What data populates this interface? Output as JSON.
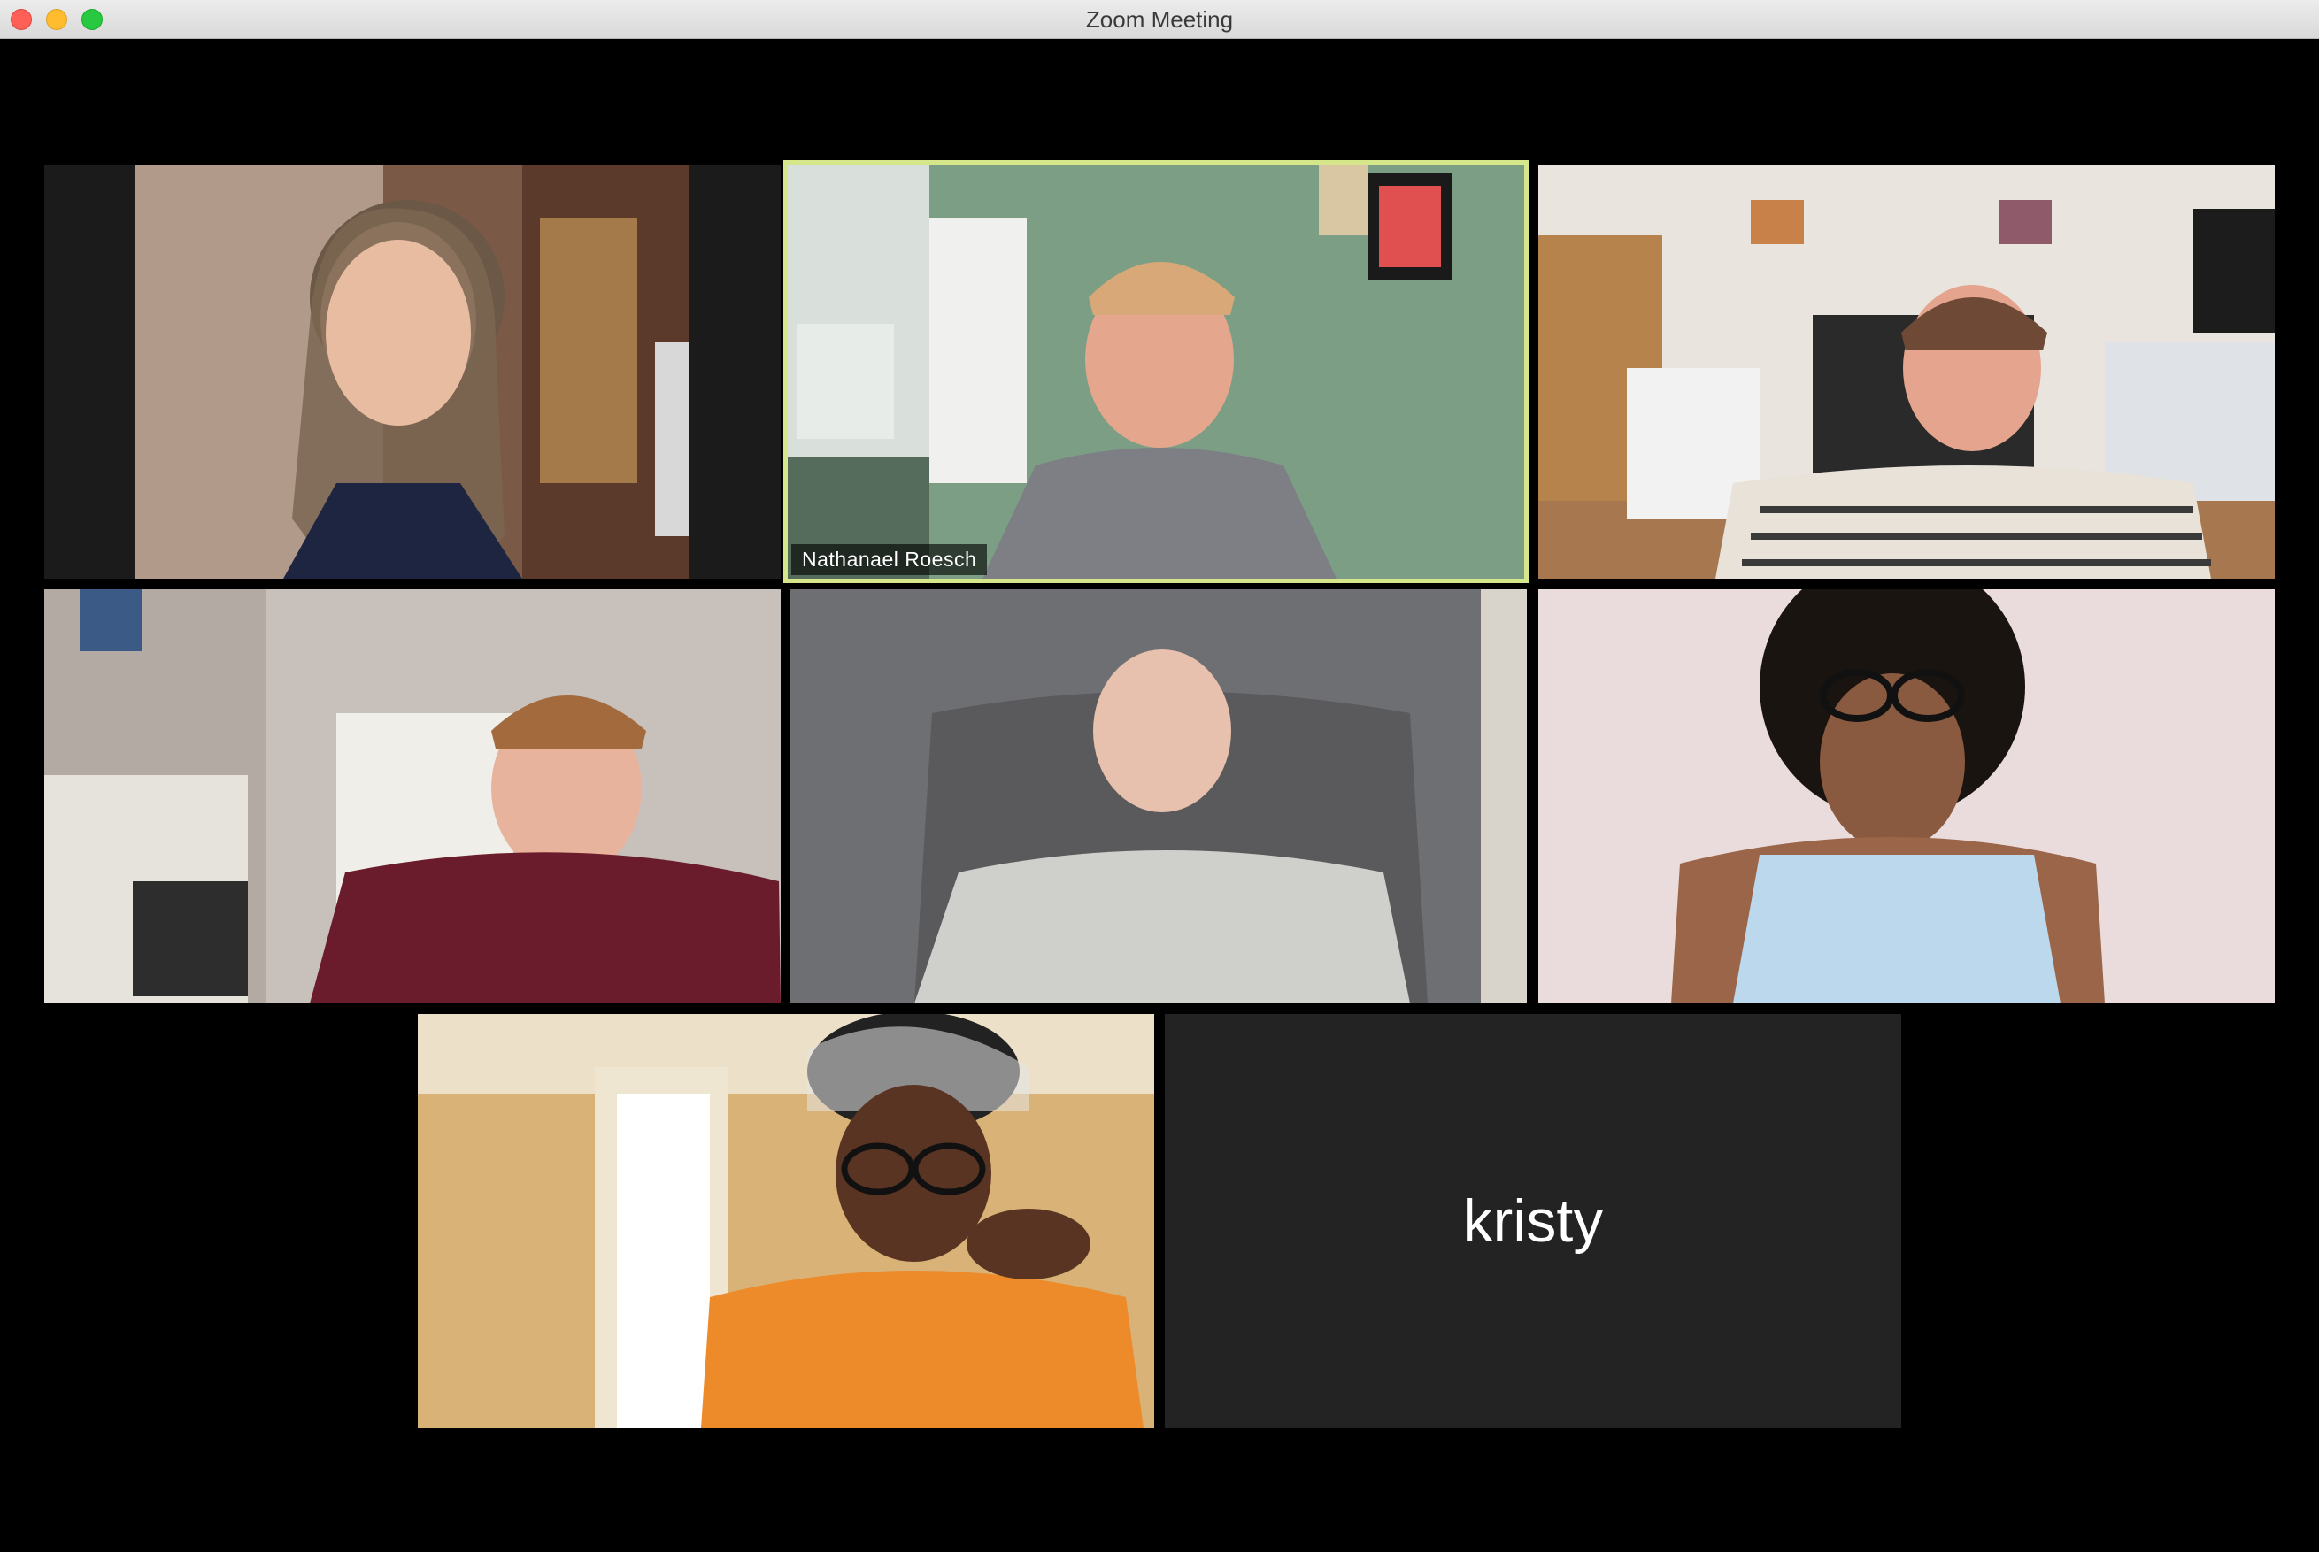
{
  "window": {
    "title": "Zoom Meeting"
  },
  "participants": [
    {
      "id": "p1",
      "video": true
    },
    {
      "id": "p2",
      "name": "Nathanael Roesch",
      "video": true,
      "active_speaker": true
    },
    {
      "id": "p3",
      "video": true
    },
    {
      "id": "p4",
      "video": true
    },
    {
      "id": "p5",
      "video": true
    },
    {
      "id": "p6",
      "video": true
    },
    {
      "id": "p7",
      "video": true
    },
    {
      "id": "p8",
      "name": "kristy",
      "video": false
    }
  ],
  "colors": {
    "active_speaker_border": "#d6e68a",
    "tile_background_no_video": "#232323",
    "window_background": "#000000"
  }
}
